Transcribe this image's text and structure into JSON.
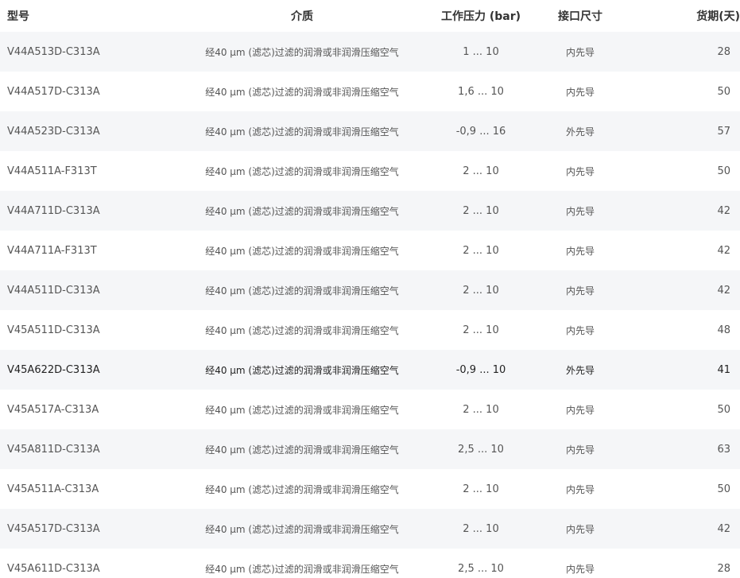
{
  "header": {
    "model": "型号",
    "medium": "介质",
    "pressure": "工作压力 (bar)",
    "port": "接口尺寸",
    "delivery": "货期(天)"
  },
  "rows": [
    {
      "model": "V44A513D-C313A",
      "medium": "经40 μm (滤芯)过滤的润滑或非润滑压缩空气",
      "pressure": "1 ... 10",
      "port": "内先导",
      "delivery": "28"
    },
    {
      "model": "V44A517D-C313A",
      "medium": "经40 μm (滤芯)过滤的润滑或非润滑压缩空气",
      "pressure": "1,6 ... 10",
      "port": "内先导",
      "delivery": "50"
    },
    {
      "model": "V44A523D-C313A",
      "medium": "经40 μm (滤芯)过滤的润滑或非润滑压缩空气",
      "pressure": "-0,9 ... 16",
      "port": "外先导",
      "delivery": "57"
    },
    {
      "model": "V44A511A-F313T",
      "medium": "经40 μm (滤芯)过滤的润滑或非润滑压缩空气",
      "pressure": "2 ... 10",
      "port": "内先导",
      "delivery": "50"
    },
    {
      "model": "V44A711D-C313A",
      "medium": "经40 μm (滤芯)过滤的润滑或非润滑压缩空气",
      "pressure": "2 ... 10",
      "port": "内先导",
      "delivery": "42"
    },
    {
      "model": "V44A711A-F313T",
      "medium": "经40 μm (滤芯)过滤的润滑或非润滑压缩空气",
      "pressure": "2 ... 10",
      "port": "内先导",
      "delivery": "42"
    },
    {
      "model": "V44A511D-C313A",
      "medium": "经40 μm (滤芯)过滤的润滑或非润滑压缩空气",
      "pressure": "2 ... 10",
      "port": "内先导",
      "delivery": "42"
    },
    {
      "model": "V45A511D-C313A",
      "medium": "经40 μm (滤芯)过滤的润滑或非润滑压缩空气",
      "pressure": "2 ... 10",
      "port": "内先导",
      "delivery": "48"
    },
    {
      "model": "V45A622D-C313A",
      "medium": "经40 μm (滤芯)过滤的润滑或非润滑压缩空气",
      "pressure": "-0,9 ... 10",
      "port": "外先导",
      "delivery": "41"
    },
    {
      "model": "V45A517A-C313A",
      "medium": "经40 μm (滤芯)过滤的润滑或非润滑压缩空气",
      "pressure": "2 ... 10",
      "port": "内先导",
      "delivery": "50"
    },
    {
      "model": "V45A811D-C313A",
      "medium": "经40 μm (滤芯)过滤的润滑或非润滑压缩空气",
      "pressure": "2,5 ... 10",
      "port": "内先导",
      "delivery": "63"
    },
    {
      "model": "V45A511A-C313A",
      "medium": "经40 μm (滤芯)过滤的润滑或非润滑压缩空气",
      "pressure": "2 ... 10",
      "port": "内先导",
      "delivery": "50"
    },
    {
      "model": "V45A517D-C313A",
      "medium": "经40 μm (滤芯)过滤的润滑或非润滑压缩空气",
      "pressure": "2 ... 10",
      "port": "内先导",
      "delivery": "42"
    },
    {
      "model": "V45A611D-C313A",
      "medium": "经40 μm (滤芯)过滤的润滑或非润滑压缩空气",
      "pressure": "2,5 ... 10",
      "port": "内先导",
      "delivery": "28"
    }
  ]
}
